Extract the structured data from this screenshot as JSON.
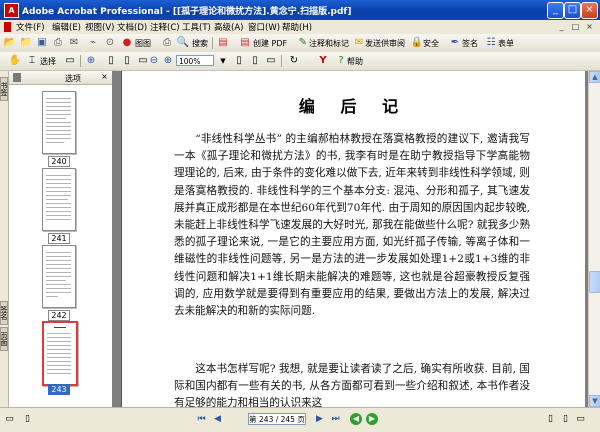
{
  "window": {
    "title": "Adobe Acrobat Professional - [[孤子理论和微扰方法].黄念宁.扫描版.pdf]",
    "app_icon": "acrobat-icon",
    "minimize": "_",
    "maximize": "□",
    "close": "×"
  },
  "menu": {
    "items": [
      "文件(F)",
      "编辑(E)",
      "视图(V)",
      "文档(D)",
      "注释(C)",
      "工具(T)",
      "高级(A)",
      "窗口(W)",
      "帮助(H)"
    ],
    "doc_controls": [
      "_",
      "□",
      "×"
    ]
  },
  "toolbar1": {
    "icons": [
      "open-icon",
      "save-icon",
      "print-icon",
      "email-icon",
      "attach-icon",
      "search-icon"
    ],
    "organize_label": "图图",
    "search_label": "搜索",
    "create_pdf_label": "创建 PDF",
    "comment_label": "注释和标记",
    "send_review_label": "发送供审阅",
    "secure_label": "安全",
    "sign_label": "签名",
    "forms_label": "表单"
  },
  "toolbar2": {
    "hand_icon": "hand-icon",
    "select_label": "选择",
    "zoom_value": "100%",
    "help_label": "帮助"
  },
  "thumbnails": {
    "header": "选项",
    "pages": [
      {
        "label": "240",
        "selected": false
      },
      {
        "label": "241",
        "selected": false
      },
      {
        "label": "242",
        "selected": false
      },
      {
        "label": "243",
        "selected": true
      }
    ]
  },
  "side_tabs": [
    "书签",
    "签名",
    "页面"
  ],
  "document": {
    "heading": "编 后 记",
    "paragraphs": [
      "“非线性科学丛书” 的主编郝柏林教授在落寞格教授的建议下, 邀请我写一本《孤子理论和微扰方法》的书, 我李有时是在助宁教授指导下学高能物理理论的, 后来, 由于条件的变化难以做下去, 近年来转到非线性科学领域, 则是落寞格教授的. 非线性科学的三个基本分支: 混沌、分形和孤子, 其飞速发展并真正成形都是在本世纪60年代到70年代. 由于周知的原因国内起步较晚, 未能赶上非线性科学飞速发展的大好时光, 那我在能做些什么呢? 就我多少熟悉的孤子理论来说, 一是它的主要应用方面, 如光纤孤子传输, 等离子体和一维磁性的非线性问题等, 另一是方法的进一步发展如处理1+2或1+3维的非线性问题和解决1+1维长期未能解决的难题等, 这也就是谷超豪教授反复强调的, 应用数学就是要得到有重要应用的结果, 要做出方法上的发展, 解决过去未能解决的和新的实际问题.",
      "这本书怎样写呢? 我想, 就是要让读者读了之后, 确实有所收获. 目前, 国际和国内都有一些有关的书, 从各方面都可看到一些介绍和叙述, 本书作者没有足够的能力和相当的认识来这"
    ]
  },
  "status": {
    "page_indicator": "第 243 / 245 页",
    "nav_icons": [
      "first-page-icon",
      "prev-page-icon",
      "next-page-icon",
      "last-page-icon",
      "back-icon",
      "forward-icon"
    ]
  }
}
